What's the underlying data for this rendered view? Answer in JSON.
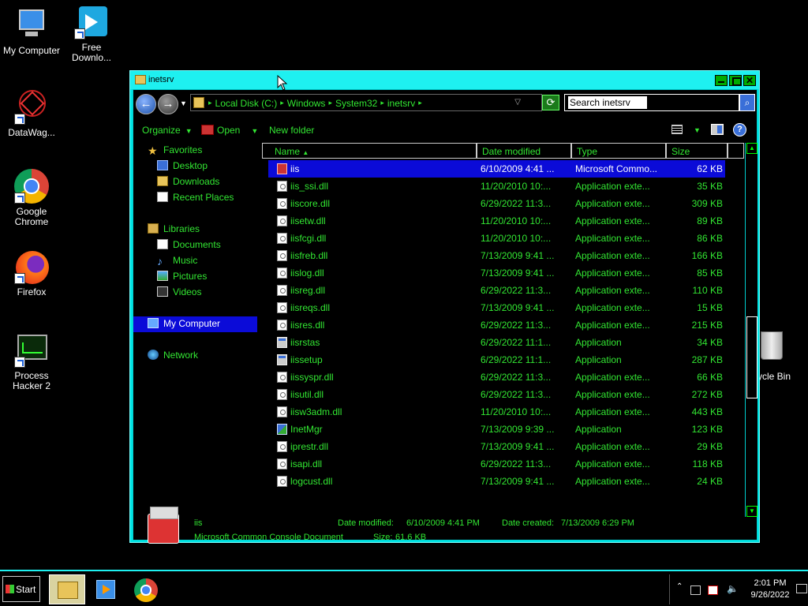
{
  "desktop": {
    "icons": [
      {
        "label": "My Computer"
      },
      {
        "label": "Free Downlo..."
      },
      {
        "label": "DataWag..."
      },
      {
        "label": "Google Chrome"
      },
      {
        "label": "Firefox"
      },
      {
        "label": "Process Hacker 2"
      }
    ],
    "recycle_bin": "ycle Bin"
  },
  "window": {
    "title": "inetsrv",
    "address": {
      "crumbs": [
        "Local Disk (C:)",
        "Windows",
        "System32",
        "inetsrv"
      ]
    },
    "search": {
      "placeholder": "Search inetsrv"
    },
    "toolbar": {
      "organize": "Organize",
      "open": "Open",
      "new_folder": "New folder"
    },
    "nav": {
      "favorites": "Favorites",
      "desktop": "Desktop",
      "downloads": "Downloads",
      "recent": "Recent Places",
      "libraries": "Libraries",
      "documents": "Documents",
      "music": "Music",
      "pictures": "Pictures",
      "videos": "Videos",
      "my_computer": "My Computer",
      "network": "Network"
    },
    "columns": {
      "name": "Name",
      "date": "Date modified",
      "type": "Type",
      "size": "Size"
    },
    "files": [
      {
        "name": "iis",
        "date": "6/10/2009 4:41 ...",
        "type": "Microsoft Commo...",
        "size": "62 KB",
        "icon": "mmc"
      },
      {
        "name": "iis_ssi.dll",
        "date": "11/20/2010 10:...",
        "type": "Application exte...",
        "size": "35 KB",
        "icon": "dll"
      },
      {
        "name": "iiscore.dll",
        "date": "6/29/2022 11:3...",
        "type": "Application exte...",
        "size": "309 KB",
        "icon": "dll"
      },
      {
        "name": "iisetw.dll",
        "date": "11/20/2010 10:...",
        "type": "Application exte...",
        "size": "89 KB",
        "icon": "dll"
      },
      {
        "name": "iisfcgi.dll",
        "date": "11/20/2010 10:...",
        "type": "Application exte...",
        "size": "86 KB",
        "icon": "dll"
      },
      {
        "name": "iisfreb.dll",
        "date": "7/13/2009 9:41 ...",
        "type": "Application exte...",
        "size": "166 KB",
        "icon": "dll"
      },
      {
        "name": "iislog.dll",
        "date": "7/13/2009 9:41 ...",
        "type": "Application exte...",
        "size": "85 KB",
        "icon": "dll"
      },
      {
        "name": "iisreg.dll",
        "date": "6/29/2022 11:3...",
        "type": "Application exte...",
        "size": "110 KB",
        "icon": "dll"
      },
      {
        "name": "iisreqs.dll",
        "date": "7/13/2009 9:41 ...",
        "type": "Application exte...",
        "size": "15 KB",
        "icon": "dll"
      },
      {
        "name": "iisres.dll",
        "date": "6/29/2022 11:3...",
        "type": "Application exte...",
        "size": "215 KB",
        "icon": "dll"
      },
      {
        "name": "iisrstas",
        "date": "6/29/2022 11:1...",
        "type": "Application",
        "size": "34 KB",
        "icon": "app"
      },
      {
        "name": "iissetup",
        "date": "6/29/2022 11:1...",
        "type": "Application",
        "size": "287 KB",
        "icon": "app"
      },
      {
        "name": "iissyspr.dll",
        "date": "6/29/2022 11:3...",
        "type": "Application exte...",
        "size": "66 KB",
        "icon": "dll"
      },
      {
        "name": "iisutil.dll",
        "date": "6/29/2022 11:3...",
        "type": "Application exte...",
        "size": "272 KB",
        "icon": "dll"
      },
      {
        "name": "iisw3adm.dll",
        "date": "11/20/2010 10:...",
        "type": "Application exte...",
        "size": "443 KB",
        "icon": "dll"
      },
      {
        "name": "InetMgr",
        "date": "7/13/2009 9:39 ...",
        "type": "Application",
        "size": "123 KB",
        "icon": "mgr"
      },
      {
        "name": "iprestr.dll",
        "date": "7/13/2009 9:41 ...",
        "type": "Application exte...",
        "size": "29 KB",
        "icon": "dll"
      },
      {
        "name": "isapi.dll",
        "date": "6/29/2022 11:3...",
        "type": "Application exte...",
        "size": "118 KB",
        "icon": "dll"
      },
      {
        "name": "logcust.dll",
        "date": "7/13/2009 9:41 ...",
        "type": "Application exte...",
        "size": "24 KB",
        "icon": "dll"
      }
    ],
    "details": {
      "name": "iis",
      "type": "Microsoft Common Console Document",
      "modified_label": "Date modified:",
      "modified": "6/10/2009 4:41 PM",
      "created_label": "Date created:",
      "created": "7/13/2009 6:29 PM",
      "size_label": "Size:",
      "size": "61.6 KB"
    }
  },
  "taskbar": {
    "start": "Start",
    "time": "2:01 PM",
    "date": "9/26/2022"
  }
}
